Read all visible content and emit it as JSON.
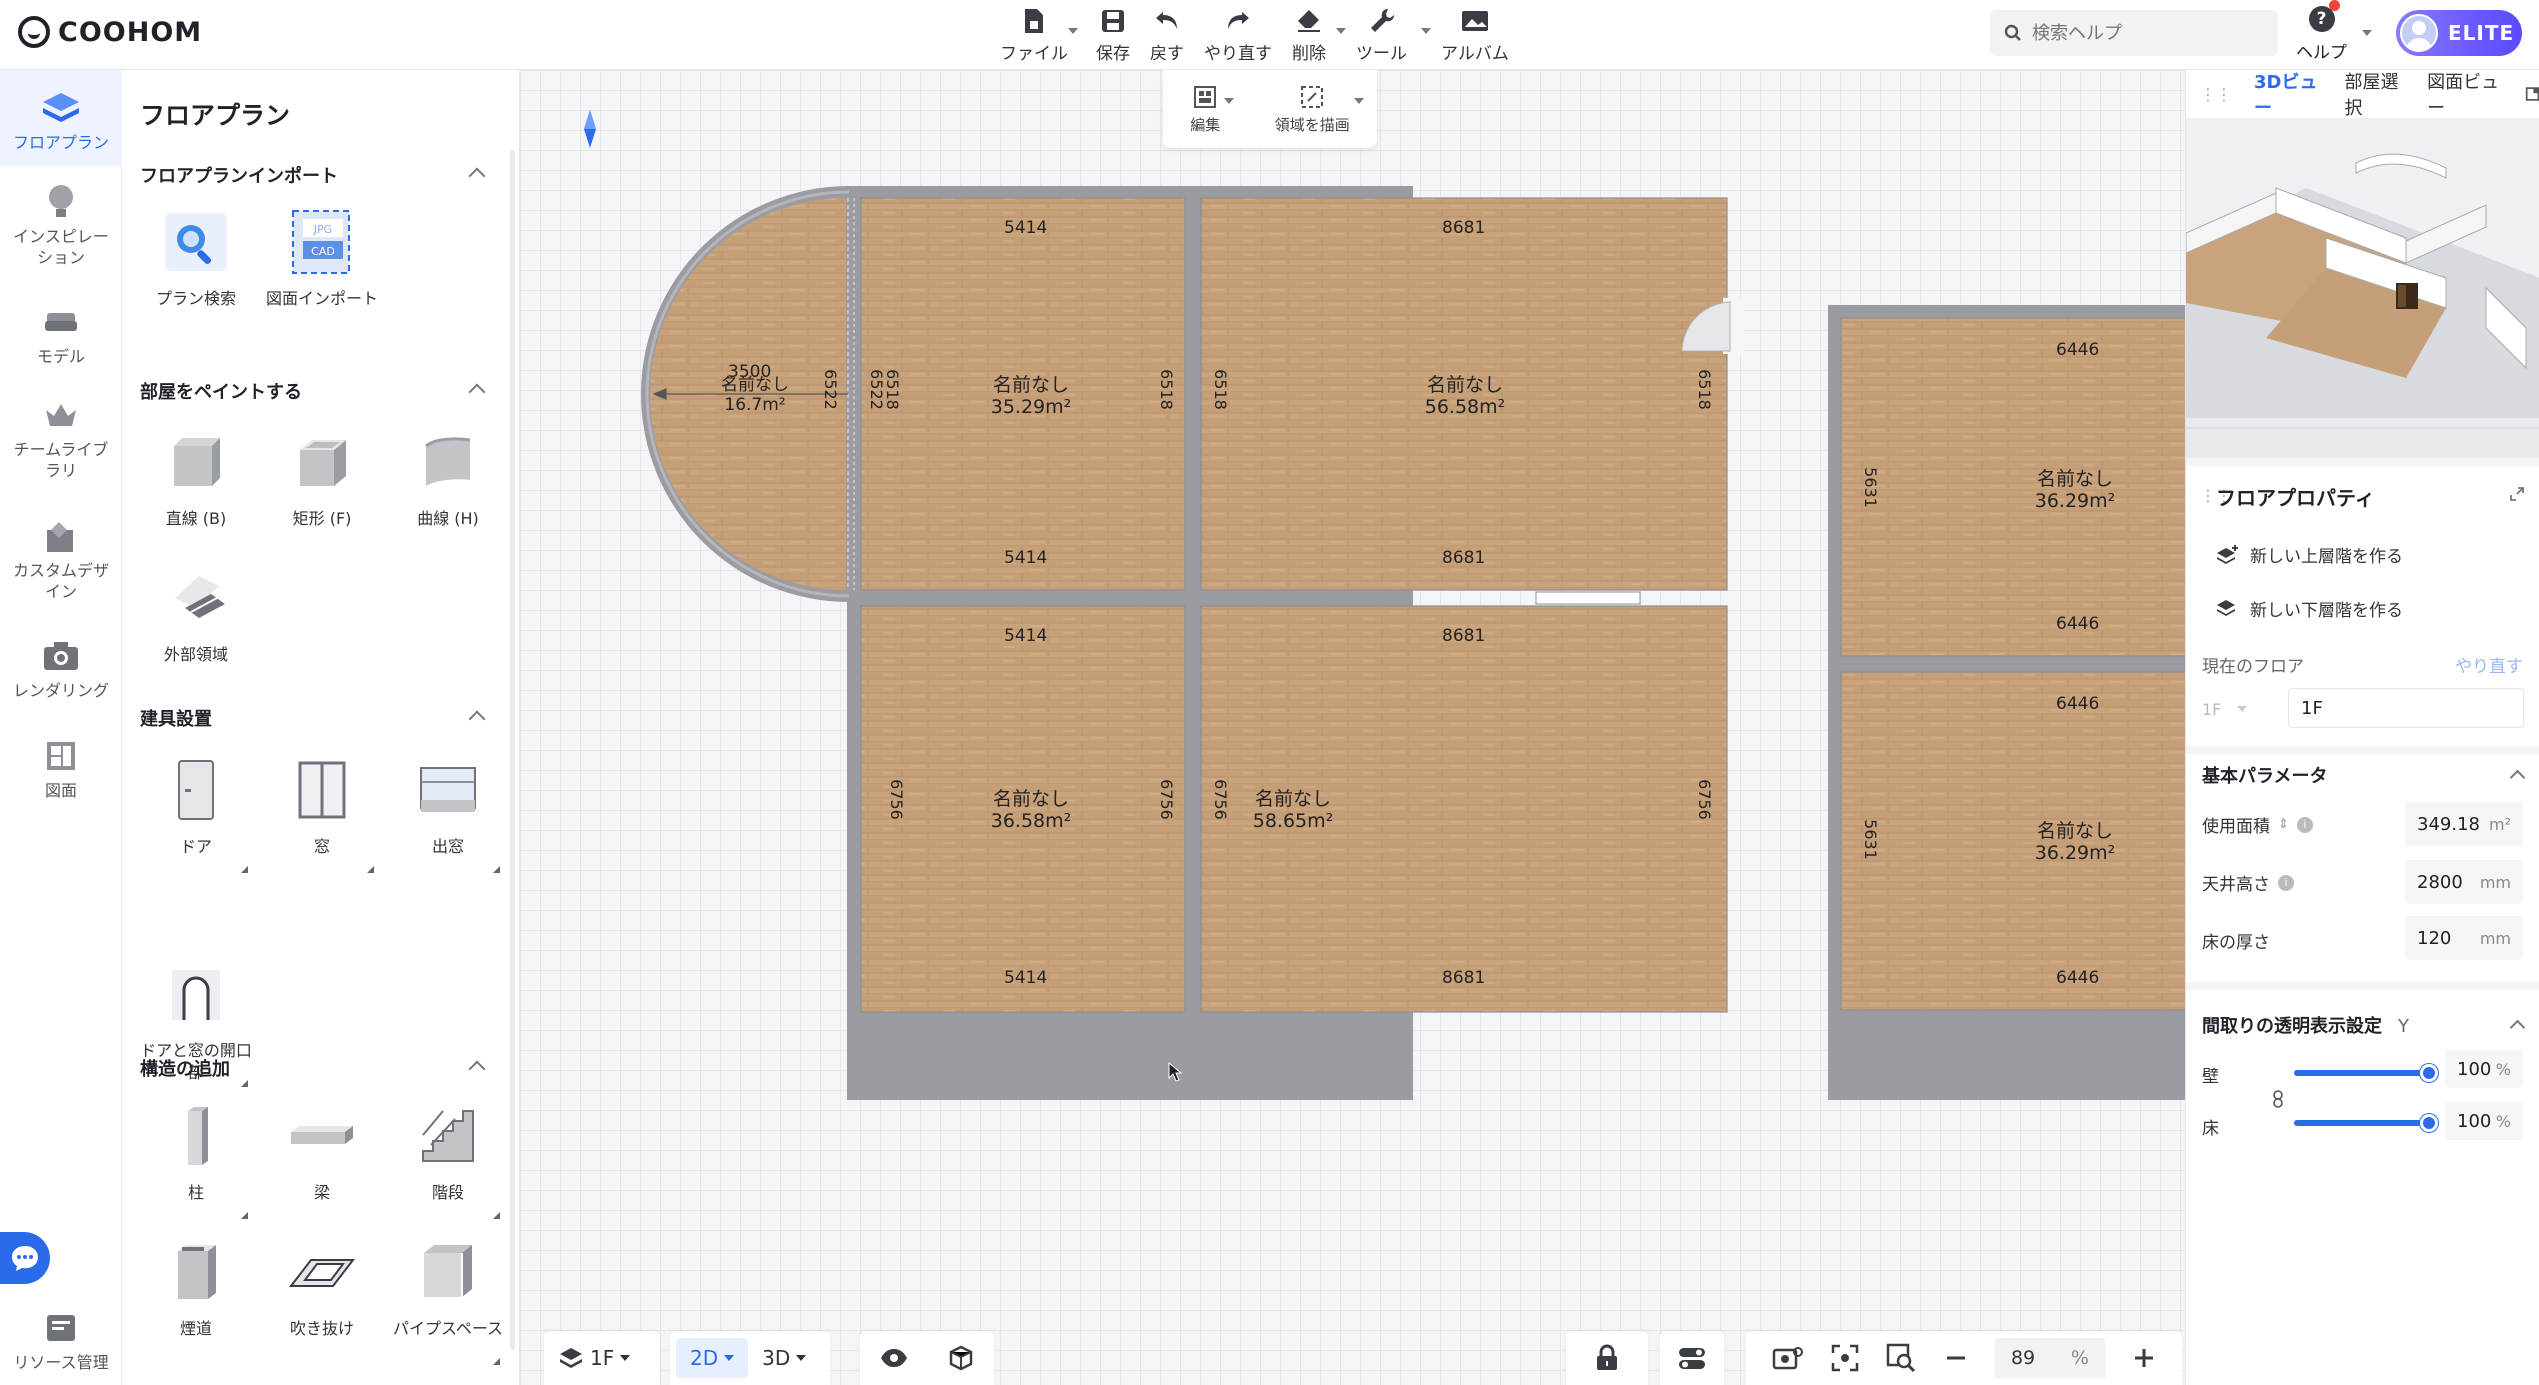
{
  "app": {
    "logo_text": "COOHOM"
  },
  "toolbar": {
    "file": "ファイル",
    "save": "保存",
    "undo": "戻す",
    "redo": "やり直す",
    "delete": "削除",
    "tools": "ツール",
    "album": "アルバム"
  },
  "search": {
    "placeholder": "検索ヘルプ"
  },
  "help": {
    "label": "ヘルプ",
    "icon": "?"
  },
  "account": {
    "badge": "ELITE"
  },
  "rail": {
    "items": [
      {
        "label": "フロアプラン"
      },
      {
        "label": "インスピレーション"
      },
      {
        "label": "モデル"
      },
      {
        "label": "チームライブラリ"
      },
      {
        "label": "カスタムデザイン"
      },
      {
        "label": "レンダリング"
      },
      {
        "label": "図面"
      },
      {
        "label": "リソース管理"
      }
    ]
  },
  "panel": {
    "title": "フロアプラン",
    "sections": {
      "import": {
        "title": "フロアプランインポート",
        "items": [
          "プラン検索",
          "図面インポート"
        ],
        "cad_tags": [
          "JPG",
          "CAD"
        ]
      },
      "paint": {
        "title": "部屋をペイントする",
        "items": [
          "直線 (B)",
          "矩形 (F)",
          "曲線 (H)",
          "外部領域"
        ]
      },
      "fixtures": {
        "title": "建具設置",
        "items": [
          "ドア",
          "窓",
          "出窓",
          "ドアと窓の開口部"
        ]
      },
      "structure": {
        "title": "構造の追加",
        "items": [
          "柱",
          "梁",
          "階段",
          "煙道",
          "吹き抜け",
          "パイプスペース"
        ]
      }
    }
  },
  "canvas": {
    "float_tools": {
      "edit": "編集",
      "draw_area": "領域を描画"
    },
    "rooms": [
      {
        "name": "名前なし",
        "area": "16.7m²",
        "dims": [
          "3500",
          "6522",
          "6518"
        ]
      },
      {
        "name": "名前なし",
        "area": "35.29m²",
        "dims": [
          "5414",
          "5414",
          "6518",
          "6518"
        ]
      },
      {
        "name": "名前なし",
        "area": "56.58m²",
        "dims": [
          "8681",
          "8681",
          "6518",
          "6518"
        ]
      },
      {
        "name": "名前なし",
        "area": "36.58m²",
        "dims": [
          "5414",
          "5414",
          "6756",
          "6756"
        ]
      },
      {
        "name": "名前なし",
        "area": "58.65m²",
        "dims": [
          "8681",
          "8681",
          "6756",
          "6756"
        ]
      },
      {
        "name": "名前なし",
        "area": "36.29m²",
        "dims": [
          "6446",
          "6446",
          "5631"
        ]
      },
      {
        "name": "名前なし",
        "area": "36.29m²",
        "dims": [
          "6446",
          "6446",
          "5631"
        ]
      }
    ],
    "bottom": {
      "floor": "1F",
      "mode_2d": "2D",
      "mode_3d": "3D",
      "zoom": "89",
      "zoom_unit": "%"
    }
  },
  "right": {
    "tabs": [
      "3Dビュー",
      "部屋選択",
      "図面ビュー"
    ],
    "props_title": "フロアプロパティ",
    "new_upper": "新しい上層階を作る",
    "new_lower": "新しい下層階を作る",
    "current_floor_label": "現在のフロア",
    "redo_link": "やり直す",
    "floor_select": "1F",
    "floor_name": "1F",
    "basic_params": "基本パラメータ",
    "usable_area_label": "使用面積",
    "usable_area": "349.18",
    "usable_area_unit": "m²",
    "ceiling_label": "天井高さ",
    "ceiling": "2800",
    "ceiling_unit": "mm",
    "floor_thick_label": "床の厚さ",
    "floor_thick": "120",
    "floor_thick_unit": "mm",
    "transparency_title": "間取りの透明表示設定",
    "transparency_key": "Y",
    "wall_label": "壁",
    "wall_value": "100",
    "floor_label": "床",
    "floor_value": "100",
    "pct": "%",
    "wall_level": 1.0,
    "floor_level": 1.0
  },
  "colors": {
    "accent": "#2b6be9",
    "wall": "#9a9ca1",
    "floor_wood": "#c9a37c"
  }
}
